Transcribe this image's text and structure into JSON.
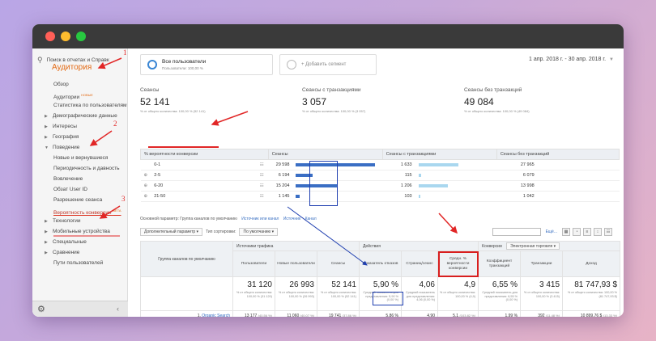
{
  "sidebar": {
    "search_placeholder": "Поиск в отчетах и Справк",
    "section_title": "Аудитория",
    "items": [
      {
        "label": "Обзор",
        "type": "child"
      },
      {
        "label": "Аудитории",
        "type": "child",
        "tag": "НОВЫЕ"
      },
      {
        "label": "Статистика по пользователям",
        "type": "child"
      },
      {
        "label": "Демографические данные",
        "type": "cat"
      },
      {
        "label": "Интересы",
        "type": "cat"
      },
      {
        "label": "География",
        "type": "cat"
      },
      {
        "label": "Поведение",
        "type": "cat-open"
      },
      {
        "label": "Новые и вернувшиеся",
        "type": "child"
      },
      {
        "label": "Периодичность и давность",
        "type": "child"
      },
      {
        "label": "Вовлечение",
        "type": "child"
      },
      {
        "label": "Обзат User ID",
        "type": "child"
      },
      {
        "label": "Разрешение сеанса",
        "type": "child"
      },
      {
        "label": "Вероятность конверсии",
        "type": "active",
        "tag": "BETA"
      },
      {
        "label": "Технологии",
        "type": "cat"
      },
      {
        "label": "Мобильные устройства",
        "type": "cat"
      },
      {
        "label": "Специальные",
        "type": "cat"
      },
      {
        "label": "Сравнение",
        "type": "cat"
      },
      {
        "label": "Пути пользователей",
        "type": "child"
      }
    ]
  },
  "segments": {
    "primary_name": "Все пользователи",
    "primary_sub": "Пользователи: 100,00 %",
    "add_label": "+ Добавить сегмент"
  },
  "date_range": "1 апр. 2018 г. - 30 апр. 2018 г.",
  "kpis": [
    {
      "label": "Сеансы",
      "value": "52 141",
      "sub": "% от общего количества: 100,00 % (52 141)"
    },
    {
      "label": "Сеансы с транзакциями",
      "value": "3 057",
      "sub": "% от общего количества: 100,00 % (3 057)"
    },
    {
      "label": "Сеансы без транзакций",
      "value": "49 084",
      "sub": "% от общего количества: 100,00 % (49 084)"
    }
  ],
  "prob_table": {
    "headers": [
      "% вероятности конверсии",
      "Сеансы",
      "Сеансы с транзакциями",
      "Сеансы без транзакций"
    ],
    "rows": [
      {
        "range": "0-1",
        "sessions": "29 598",
        "s_frac": 0.95,
        "with_tx": "1 633",
        "w_frac": 0.53,
        "without_tx": "27 965"
      },
      {
        "range": "2-5",
        "sessions": "6 194",
        "s_frac": 0.2,
        "with_tx": "115",
        "w_frac": 0.04,
        "without_tx": "6 079"
      },
      {
        "range": "6-20",
        "sessions": "15 204",
        "s_frac": 0.49,
        "with_tx": "1 206",
        "w_frac": 0.39,
        "without_tx": "13 998"
      },
      {
        "range": "21-50",
        "sessions": "1 145",
        "s_frac": 0.04,
        "with_tx": "103",
        "w_frac": 0.03,
        "without_tx": "1 042"
      }
    ]
  },
  "channel_section": {
    "params_label": "Основной параметр:",
    "param_active": "Группа каналов по умолчанию",
    "param_links": [
      "Источник или канал",
      "Источник",
      "Канал"
    ],
    "secondary_dd": "Дополнительный параметр",
    "sort_dd": "Тип сортировки:",
    "sort_value": "По умолчанию",
    "advanced": "Ещё...",
    "conversions_label": "Конверсии",
    "conversions_value": "Электронная торговля",
    "group_headers": [
      "Источники трафика",
      "Действия"
    ],
    "col_first": "Группа каналов по умолчанию",
    "cols": [
      "Пользователи",
      "Новые пользователи",
      "Сеансы",
      "Показатель отказов",
      "Страниц/сеанс",
      "Средн. % вероятности конверсии",
      "Коэффициент транзакций",
      "Транзакции",
      "Доход"
    ],
    "totals": [
      {
        "value": "31 120",
        "sub": "% от общего количества: 100,00 % (31 120)"
      },
      {
        "value": "26 993",
        "sub": "% от общего количества: 100,00 % (26 993)"
      },
      {
        "value": "52 141",
        "sub": "% от общего количества: 100,00 % (52 141)"
      },
      {
        "value": "5,90 %",
        "sub": "Средний показатель для представления: 5,90 % (0,00 %)"
      },
      {
        "value": "4,06",
        "sub": "Средний показатель для представления: 4,06 (0,00 %)"
      },
      {
        "value": "4,9",
        "sub": "% от общего количества: 100,00 % (4,9)"
      },
      {
        "value": "6,55 %",
        "sub": "Средний показатель для представления: 6,55 % (0,00 %)"
      },
      {
        "value": "3 415",
        "sub": "% от общего количества: 100,00 % (3 415)"
      },
      {
        "value": "81 747,93 $",
        "sub": "% от общего количества: 100,00 % (81 747,93 $)"
      }
    ],
    "row1": {
      "index": "1.",
      "channel": "Organic Search",
      "cells": [
        {
          "v": "13 177",
          "p": "(40,56 %)"
        },
        {
          "v": "11 060",
          "p": "(40,07 %)"
        },
        {
          "v": "19 741",
          "p": "(37,86 %)"
        },
        {
          "v": "5,86 %",
          "p": ""
        },
        {
          "v": "4,90",
          "p": ""
        },
        {
          "v": "5,1",
          "p": "(103,82 %)"
        },
        {
          "v": "1,99 %",
          "p": ""
        },
        {
          "v": "392",
          "p": "(11,48 %)"
        },
        {
          "v": "10 899,76 $",
          "p": "(13,33 %)"
        }
      ]
    }
  },
  "annotations": [
    "1",
    "2",
    "3"
  ],
  "colors": {
    "accent": "#e12626",
    "orange": "#e36b16",
    "bar_dark": "#3a6ec4",
    "bar_light": "#a9d7ef",
    "box_blue": "#1f3fb0"
  }
}
